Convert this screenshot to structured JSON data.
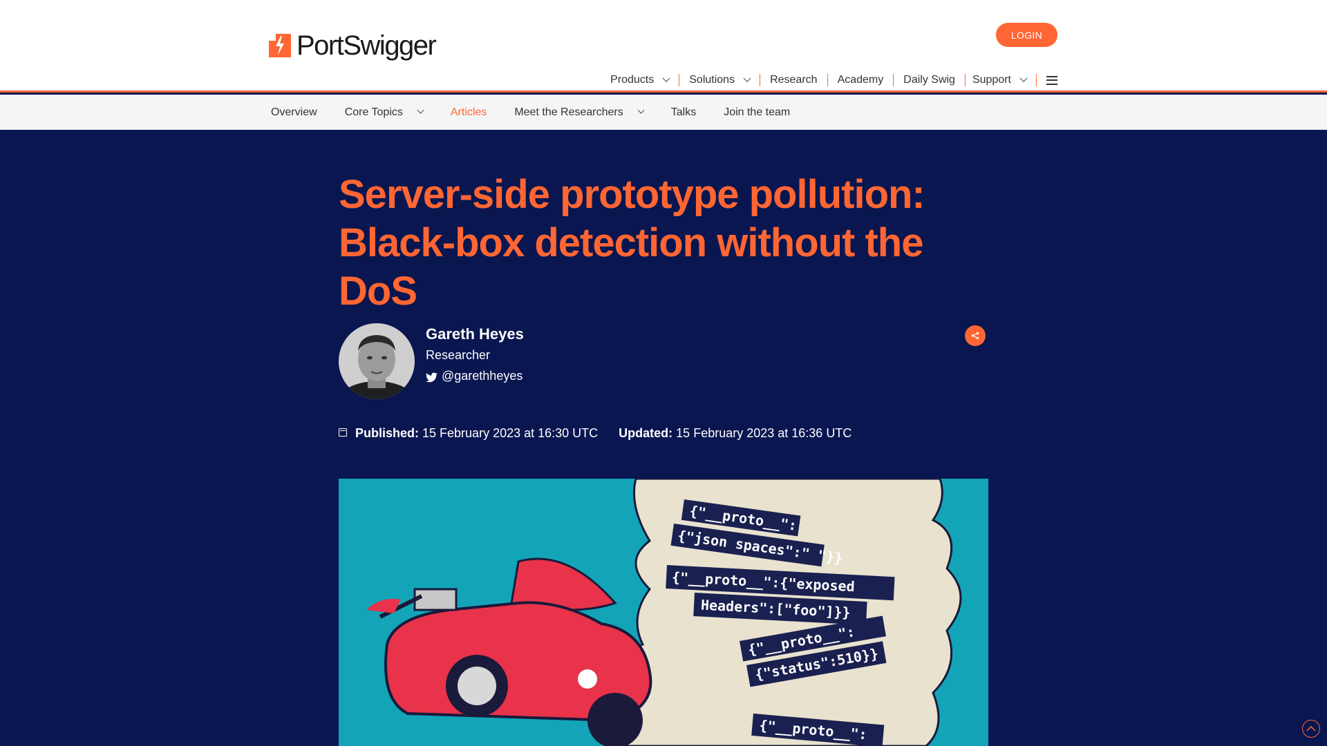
{
  "header": {
    "brand": "PortSwigger",
    "login_label": "LOGIN",
    "nav": [
      {
        "label": "Products",
        "has_dropdown": true
      },
      {
        "label": "Solutions",
        "has_dropdown": true
      },
      {
        "label": "Research",
        "has_dropdown": false
      },
      {
        "label": "Academy",
        "has_dropdown": false
      },
      {
        "label": "Daily Swig",
        "has_dropdown": false
      },
      {
        "label": "Support",
        "has_dropdown": true
      }
    ],
    "menu_icon": "hamburger-icon"
  },
  "subnav": {
    "items": [
      {
        "label": "Overview",
        "has_dropdown": false,
        "active": false
      },
      {
        "label": "Core Topics",
        "has_dropdown": true,
        "active": false
      },
      {
        "label": "Articles",
        "has_dropdown": false,
        "active": true
      },
      {
        "label": "Meet the Researchers",
        "has_dropdown": true,
        "active": false
      },
      {
        "label": "Talks",
        "has_dropdown": false,
        "active": false
      },
      {
        "label": "Join the team",
        "has_dropdown": false,
        "active": false
      }
    ]
  },
  "article": {
    "title": "Server-side prototype pollution: Black-box detection without the DoS",
    "author": {
      "name": "Gareth Heyes",
      "role": "Researcher",
      "twitter": "@garethheyes"
    },
    "published_label": "Published:",
    "published": "15 February 2023 at 16:30 UTC",
    "updated_label": "Updated:",
    "updated": "15 February 2023 at 16:36 UTC",
    "image": {
      "description": "Illustration of a red hot-rod car with skull flag driving through smoke clouds containing JSON prototype pollution payloads",
      "payloads": [
        "{\"__proto__\":{\"json spaces\":\" \"}}",
        "{\"__proto__\":{\"exposedHeaders\":[\"foo\"]}}",
        "{\"__proto__\":{\"status\":510}}",
        "{\"__proto__\":"
      ]
    }
  },
  "colors": {
    "accent": "#ff6633",
    "hero_bg": "#0a1650",
    "image_bg": "#13a4b8",
    "subnav_bg": "#f5f5f5"
  }
}
